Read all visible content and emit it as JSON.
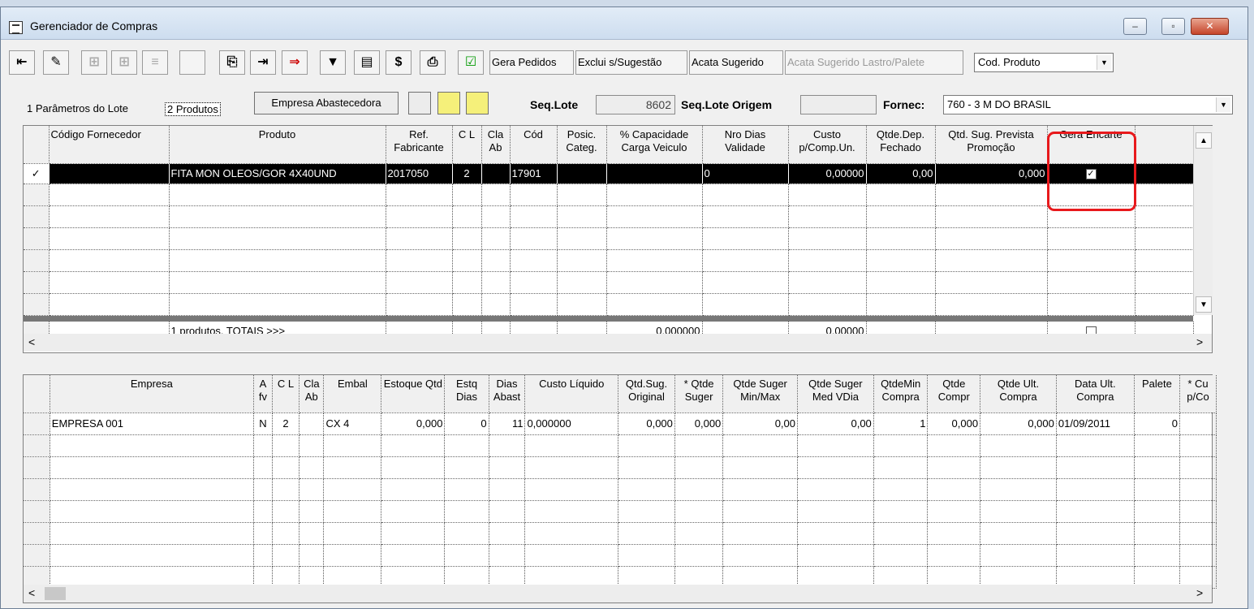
{
  "window": {
    "title": "Gerenciador de Compras",
    "minimize": "–",
    "maximize": "▫",
    "close": "✕"
  },
  "toolbar": {
    "gera_pedidos": "Gera Pedidos",
    "exclui": "Exclui s/Sugestão",
    "acata_sugerido": "Acata Sugerido",
    "acata_lastro": "Acata Sugerido Lastro/Palete",
    "order_by": "Cod. Produto"
  },
  "tabs": {
    "tab1": "1 Parâmetros do Lote",
    "tab2": "2 Produtos",
    "empresa_btn": "Empresa Abastecedora"
  },
  "header": {
    "seq_lote_label": "Seq.Lote",
    "seq_lote_value": "8602",
    "seq_origem_label": "Seq.Lote Origem",
    "seq_origem_value": "",
    "fornec_label": "Fornec:",
    "fornec_value": "760 - 3 M DO BRASIL"
  },
  "products": {
    "columns": [
      "Código Fornecedor",
      "Produto",
      "Ref. Fabricante",
      "C L",
      "Cla Ab",
      "Cód",
      "Posic. Categ.",
      "% Capacidade Carga Veiculo",
      "Nro Dias Validade",
      "Custo p/Comp.Un.",
      "Qtde.Dep. Fechado",
      "Qtd. Sug. Prevista Promoção",
      "Gera Encarte"
    ],
    "row": {
      "ind": "✓",
      "cod_forn": "",
      "produto": "FITA MON OLEOS/GOR 4X40UND",
      "ref": "2017050",
      "cl": "2",
      "cla": "",
      "cod": "17901",
      "posic": "",
      "cap": "",
      "dias": "0",
      "custo": "0,00000",
      "qtde_dep": "0,00",
      "qtd_sug": "0,000",
      "gera": "✓"
    },
    "totals": {
      "label": "1 produtos. TOTAIS >>>",
      "cap": "0,000000",
      "custo": "0,00000"
    }
  },
  "empresa": {
    "columns": [
      "Empresa",
      "A fv",
      "C L",
      "Cla Ab",
      "Embal",
      "Estoque Qtd",
      "Estq Dias",
      "Dias Abast",
      "Custo Líquido",
      "Qtd.Sug. Original",
      "* Qtde Suger",
      "Qtde Suger Min/Max",
      "Qtde Suger Med VDia",
      "QtdeMin Compra",
      "Qtde Compr",
      "Qtde Ult. Compra",
      "Data Ult. Compra",
      "Palete",
      "* Cu p/Co"
    ],
    "row": {
      "empresa": "EMPRESA 001",
      "afv": "N",
      "cl": "2",
      "cla": "",
      "embal": "CX 4",
      "estoque": "0,000",
      "estq_dias": "0",
      "dias_abast": "11",
      "custo": "0,000000",
      "qtd_sug": "0,000",
      "qtde_suger": "0,000",
      "minmax": "0,00",
      "medvdia": "0,00",
      "qtdemin": "1",
      "qtde_compr": "0,000",
      "qtde_ult": "0,000",
      "data_ult": "01/09/2011",
      "palete": "0",
      "cu": ""
    }
  },
  "scroll": {
    "left": "<",
    "right": ">",
    "up": "▲",
    "down": "▼"
  }
}
